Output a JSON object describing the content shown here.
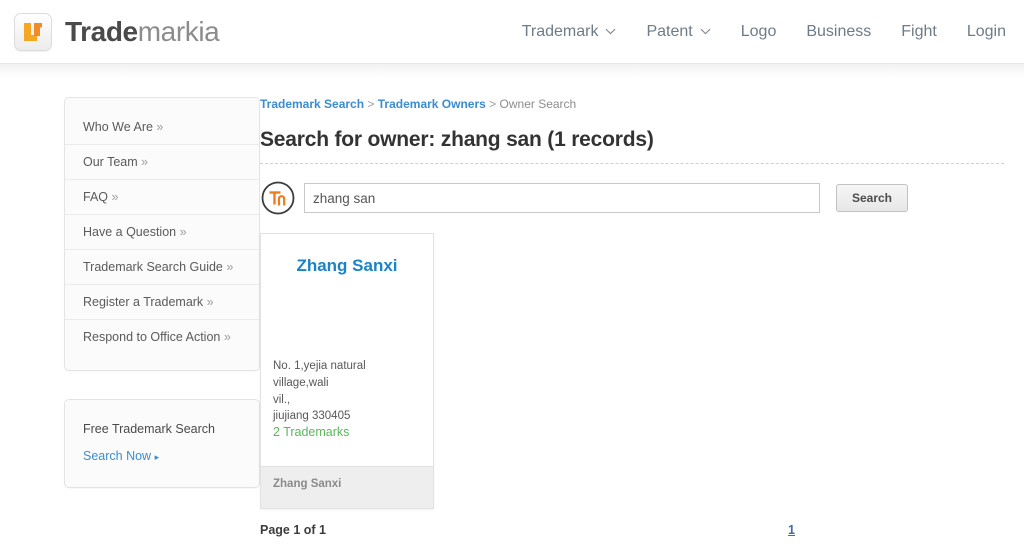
{
  "header": {
    "logo": {
      "icon": "trademarkia-lf-logo-icon",
      "bold": "Trade",
      "light": "markia"
    },
    "nav": [
      {
        "label": "Trademark",
        "has_caret": true
      },
      {
        "label": "Patent",
        "has_caret": true
      },
      {
        "label": "Logo",
        "has_caret": false
      },
      {
        "label": "Business",
        "has_caret": false
      },
      {
        "label": "Fight",
        "has_caret": false
      },
      {
        "label": "Login",
        "has_caret": false
      }
    ]
  },
  "sidebar": {
    "links": [
      {
        "label": "Who We Are",
        "arrows": "»"
      },
      {
        "label": "Our Team",
        "arrows": "»"
      },
      {
        "label": "FAQ",
        "arrows": "»"
      },
      {
        "label": "Have a Question",
        "arrows": "»"
      },
      {
        "label": "Trademark Search Guide",
        "arrows": "»"
      },
      {
        "label": "Register a Trademark",
        "arrows": "»"
      },
      {
        "label": "Respond to Office Action",
        "arrows": "»"
      }
    ],
    "promo": {
      "title": "Free Trademark Search",
      "link": "Search Now",
      "link_arrow": "▸"
    }
  },
  "breadcrumb": {
    "items": [
      {
        "label": "Trademark Search",
        "link": true
      },
      {
        "label": "Trademark Owners",
        "link": true
      },
      {
        "label": "Owner Search",
        "link": false
      }
    ],
    "separator": ">"
  },
  "main": {
    "title": "Search for owner: zhang san (1 records)",
    "search": {
      "icon": "tm-circle-icon",
      "value": "zhang san",
      "placeholder": "zhang san",
      "button_label": "Search"
    },
    "results": [
      {
        "name": "Zhang Sanxi",
        "address_line_1": "No. 1,yejia natural village,wali",
        "address_line_2": "vil.,",
        "address_line_3": "jiujiang 330405",
        "trademark_count": "2 Trademarks",
        "footer_name": "Zhang Sanxi"
      }
    ],
    "pagination": {
      "page_of": "Page 1 of 1",
      "pages": [
        "1"
      ]
    }
  },
  "colors": {
    "link_blue": "#3a8dd0",
    "card_name_blue": "#1a84c7",
    "trademark_green": "#5bb75b",
    "logo_orange": "#f08b2a",
    "text_dark": "#333333"
  }
}
